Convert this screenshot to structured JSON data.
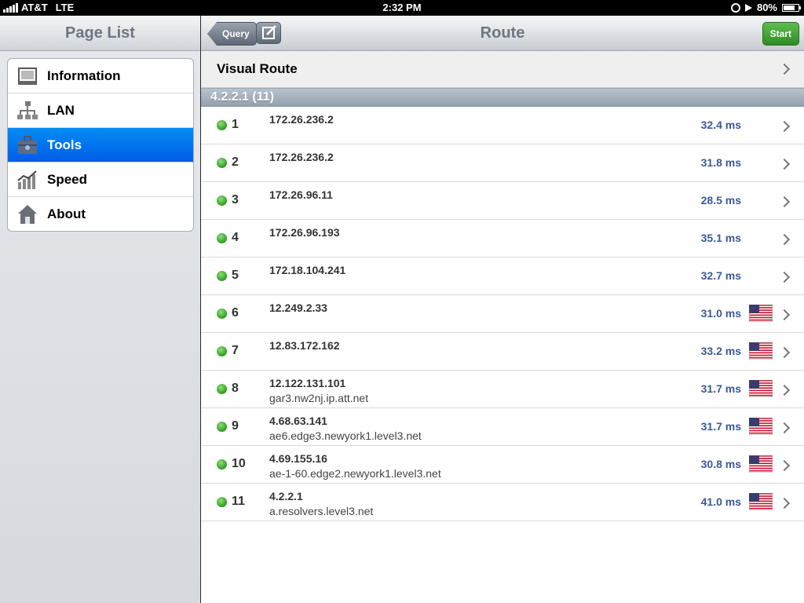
{
  "status": {
    "carrier": "AT&T",
    "network": "LTE",
    "time": "2:32 PM",
    "battery": "80%",
    "battery_level": 0.8
  },
  "master": {
    "title": "Page List",
    "items": [
      {
        "label": "Information",
        "icon": "information-icon"
      },
      {
        "label": "LAN",
        "icon": "network-icon"
      },
      {
        "label": "Tools",
        "icon": "toolbox-icon",
        "selected": true
      },
      {
        "label": "Speed",
        "icon": "speed-chart-icon"
      },
      {
        "label": "About",
        "icon": "home-icon"
      }
    ]
  },
  "detail": {
    "title": "Route",
    "query_label": "Query",
    "start_label": "Start",
    "visual_route_label": "Visual Route",
    "section_header": "4.2.2.1 (11)",
    "hops": [
      {
        "num": "1",
        "ip": "172.26.236.2",
        "host": "",
        "ms": "32.4 ms",
        "flag": false
      },
      {
        "num": "2",
        "ip": "172.26.236.2",
        "host": "",
        "ms": "31.8 ms",
        "flag": false
      },
      {
        "num": "3",
        "ip": "172.26.96.11",
        "host": "",
        "ms": "28.5 ms",
        "flag": false
      },
      {
        "num": "4",
        "ip": "172.26.96.193",
        "host": "",
        "ms": "35.1 ms",
        "flag": false
      },
      {
        "num": "5",
        "ip": "172.18.104.241",
        "host": "",
        "ms": "32.7 ms",
        "flag": false
      },
      {
        "num": "6",
        "ip": "12.249.2.33",
        "host": "",
        "ms": "31.0 ms",
        "flag": true
      },
      {
        "num": "7",
        "ip": "12.83.172.162",
        "host": "",
        "ms": "33.2 ms",
        "flag": true
      },
      {
        "num": "8",
        "ip": "12.122.131.101",
        "host": "gar3.nw2nj.ip.att.net",
        "ms": "31.7 ms",
        "flag": true
      },
      {
        "num": "9",
        "ip": "4.68.63.141",
        "host": "ae6.edge3.newyork1.level3.net",
        "ms": "31.7 ms",
        "flag": true
      },
      {
        "num": "10",
        "ip": "4.69.155.16",
        "host": "ae-1-60.edge2.newyork1.level3.net",
        "ms": "30.8 ms",
        "flag": true
      },
      {
        "num": "11",
        "ip": "4.2.2.1",
        "host": "a.resolvers.level3.net",
        "ms": "41.0 ms",
        "flag": true
      }
    ]
  },
  "colors": {
    "selected_row": "#0172eb",
    "status_ok": "#34a822",
    "latency_text": "#3b5998",
    "start_button": "#3fa232"
  }
}
